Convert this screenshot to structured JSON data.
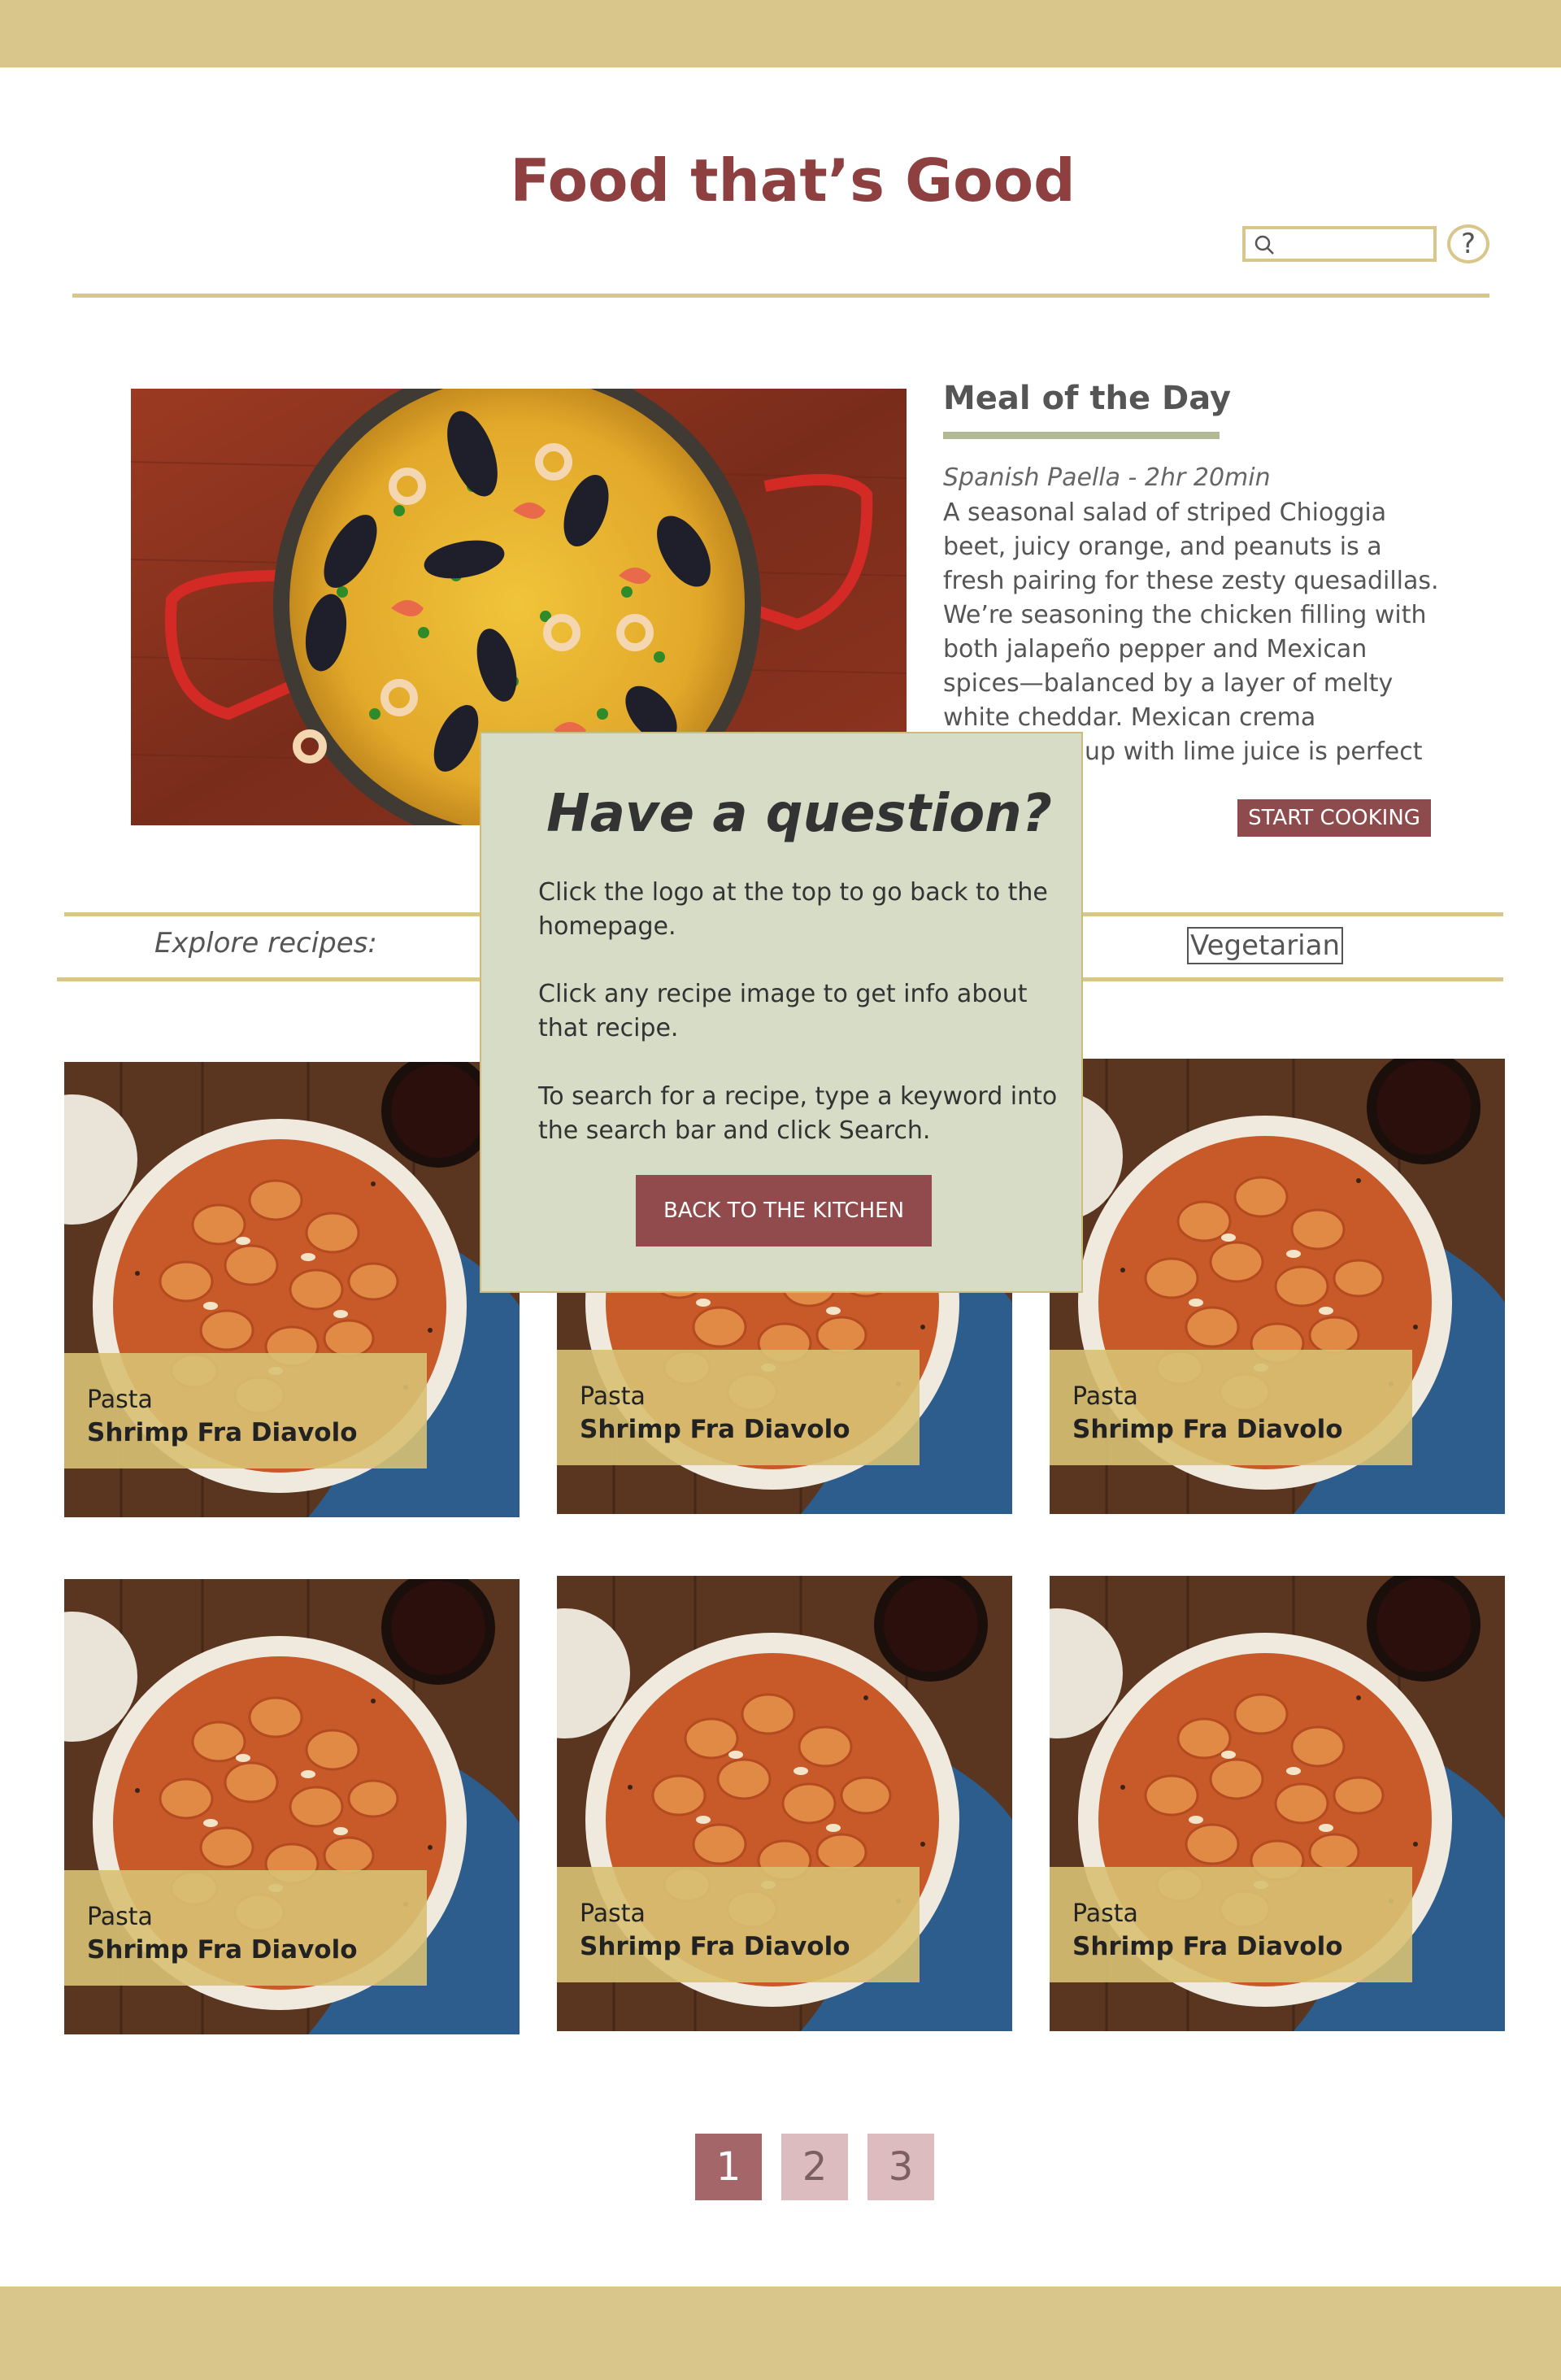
{
  "header": {
    "logo_text": "Food that’s Good",
    "search": {
      "placeholder": "",
      "icon": "search-icon"
    },
    "help": {
      "label": "?",
      "icon": "question-icon"
    }
  },
  "meal_of_day": {
    "heading": "Meal of the Day",
    "subtitle": "Spanish Paella - 2hr 20min",
    "description": "A seasonal salad of striped Chioggia beet, juicy orange, and peanuts is a fresh pairing for these zesty quesadillas. We’re seasoning the chicken filling with both jalapeño pepper and Mexican spices—balanced by a layer of melty white cheddar. Mexican crema brightened up with lime juice is perfect for dipping.",
    "button_label": "START COOKING"
  },
  "explore": {
    "label": "Explore recipes:",
    "filters": [
      "Vegetarian"
    ]
  },
  "recipes": [
    {
      "category": "Pasta",
      "name": "Shrimp Fra Diavolo"
    },
    {
      "category": "Pasta",
      "name": "Shrimp Fra Diavolo"
    },
    {
      "category": "Pasta",
      "name": "Shrimp Fra Diavolo"
    },
    {
      "category": "Pasta",
      "name": "Shrimp Fra Diavolo"
    },
    {
      "category": "Pasta",
      "name": "Shrimp Fra Diavolo"
    },
    {
      "category": "Pasta",
      "name": "Shrimp Fra Diavolo"
    }
  ],
  "pagination": {
    "pages": [
      "1",
      "2",
      "3"
    ],
    "current": "1"
  },
  "modal": {
    "title": "Have a question?",
    "paragraphs": [
      "Click the logo at the top to go back to the homepage.",
      "Click any recipe image to get info about that recipe.",
      "To search for a recipe, type a keyword into the search bar and click Search."
    ],
    "button_label": "BACK TO THE KITCHEN"
  },
  "colors": {
    "accent_gold": "#d8c68a",
    "brand_red": "#8e4040",
    "modal_bg": "#d6dcc6",
    "page_active": "#a56669",
    "page_inactive": "#dcbcbf"
  }
}
